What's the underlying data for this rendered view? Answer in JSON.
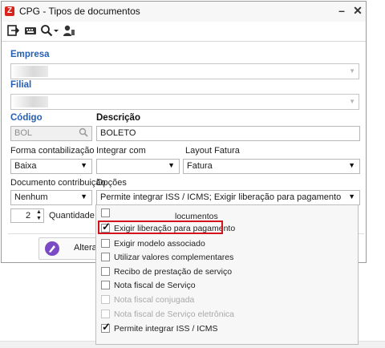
{
  "window": {
    "title": "CPG - Tipos de documentos",
    "app_icon_letter": "Z"
  },
  "toolbar": {
    "icons": [
      "exit-icon",
      "keyboard-icon",
      "search-icon",
      "dropdown-arrow-icon",
      "user-icon"
    ]
  },
  "form": {
    "empresa_label": "Empresa",
    "filial_label": "Filial",
    "codigo_label": "Código",
    "codigo_value": "BOL",
    "descricao_label": "Descrição",
    "descricao_value": "BOLETO",
    "forma_label": "Forma contabilização",
    "forma_value": "Baixa",
    "integrar_label": "Integrar com",
    "integrar_value": "",
    "layout_label": "Layout Fatura",
    "layout_value": "Fatura",
    "doc_contrib_label": "Documento contribuição",
    "doc_contrib_value": "Nenhum",
    "opcoes_label": "Opções",
    "opcoes_value": "Permite integrar ISS / ICMS; Exigir liberação para pagamento",
    "quantidade_value": "2",
    "quantidade_label": "Quantidade de",
    "alterar_label": "Alterar"
  },
  "options_list": [
    {
      "label": "locumentos",
      "checked": false,
      "disabled": false
    },
    {
      "label": "Exigir liberação para pagamento",
      "checked": true,
      "disabled": false
    },
    {
      "label": "Exigir modelo associado",
      "checked": false,
      "disabled": false
    },
    {
      "label": "Utilizar valores complementares",
      "checked": false,
      "disabled": false
    },
    {
      "label": "Recibo de prestação de serviço",
      "checked": false,
      "disabled": false
    },
    {
      "label": "Nota fiscal de Serviço",
      "checked": false,
      "disabled": false
    },
    {
      "label": "Nota fiscal conjugada",
      "checked": false,
      "disabled": true
    },
    {
      "label": "Nota fiscal de Serviço eletrônica",
      "checked": false,
      "disabled": true
    },
    {
      "label": "Permite integrar ISS / ICMS",
      "checked": true,
      "disabled": false
    }
  ],
  "colors": {
    "label_blue": "#2660b4",
    "highlight_red": "#d4101a",
    "app_red": "#d8231c"
  }
}
